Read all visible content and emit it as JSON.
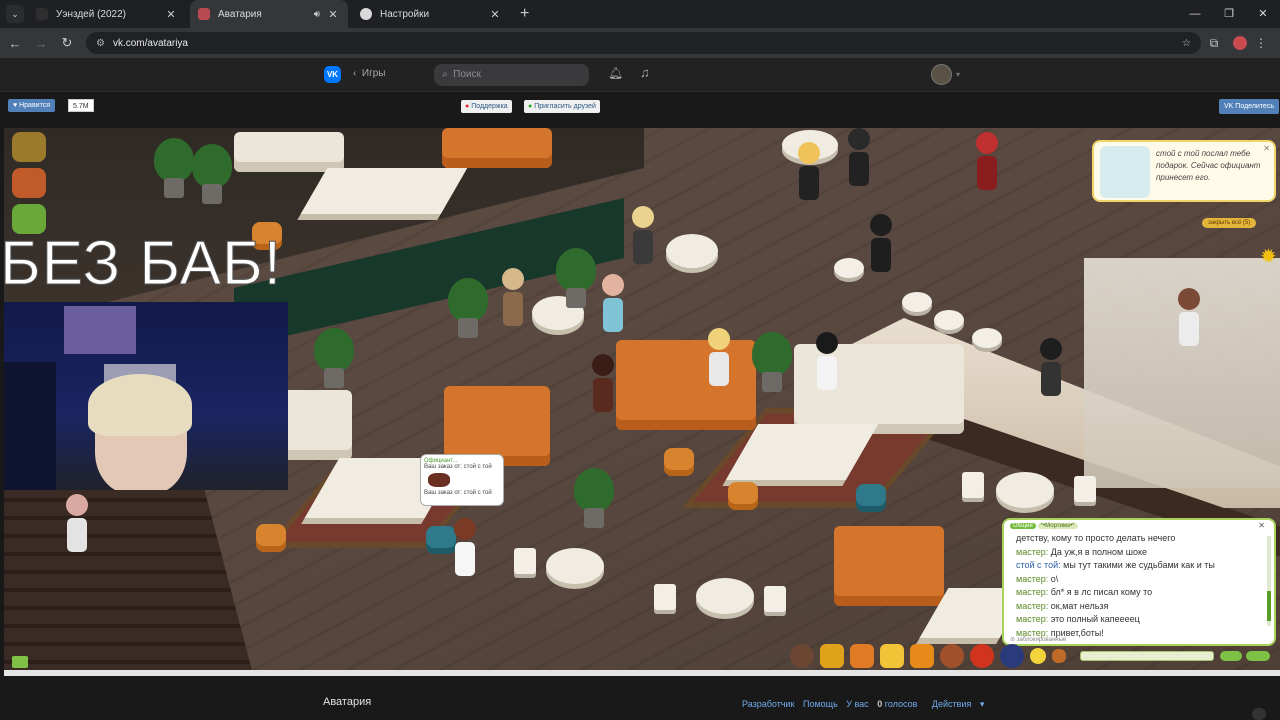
{
  "browser": {
    "tabs": [
      {
        "title": "Уэнздей (2022)",
        "favicon_color": "#2f2f2f"
      },
      {
        "title": "Аватария",
        "favicon_color": "#b94a52"
      },
      {
        "title": "Настройки",
        "favicon_color": "#d9d9d9"
      }
    ],
    "url": "vk.com/avatariya"
  },
  "vk_header": {
    "logo": "VK",
    "games_label": "Игры",
    "search_placeholder": "Поиск"
  },
  "app_bar": {
    "like_label": "Нравится",
    "like_count": "5.7M",
    "support_label": "Поддержка",
    "invite_label": "Пригласить друзей",
    "share_label": "Поделитесь"
  },
  "game": {
    "overlay_text": "БЕЗ БАБ!",
    "speech_bubble": "стой с той послал тебе подарок. Сейчас официант принесет его.",
    "close_all_label": "закрыть всё (5)",
    "waiter_bubble": {
      "name": "Официант...",
      "line1": "Ваш заказ от: стой с той",
      "line2": "Ваш заказ от: стой с той"
    },
    "chat": {
      "tab_general": "Общий",
      "tab_other": "*•Мортимэ•*",
      "messages": [
        {
          "name": "",
          "text": "детству, кому то просто делать нечего"
        },
        {
          "name": "мастер:",
          "text": "Да уж,я в полном шоке"
        },
        {
          "name": "стой с той:",
          "text": "мы тут такими же судьбами как и ты"
        },
        {
          "name": "мастер:",
          "text": "о\\"
        },
        {
          "name": "мастер:",
          "text": "бл* я в лс писал кому то"
        },
        {
          "name": "мастер:",
          "text": "ок,мат нельзя"
        },
        {
          "name": "мастер:",
          "text": "это полный капеееец"
        },
        {
          "name": "мастер:",
          "text": "привет,боты!"
        }
      ],
      "blocked_label": "заблокированные"
    }
  },
  "footer": {
    "app_title": "Аватария",
    "developer_link": "Разработчик",
    "help_link": "Помощь",
    "votes_prefix": "У вас",
    "votes_count": "0",
    "votes_suffix": "голосов",
    "actions_label": "Действия"
  }
}
